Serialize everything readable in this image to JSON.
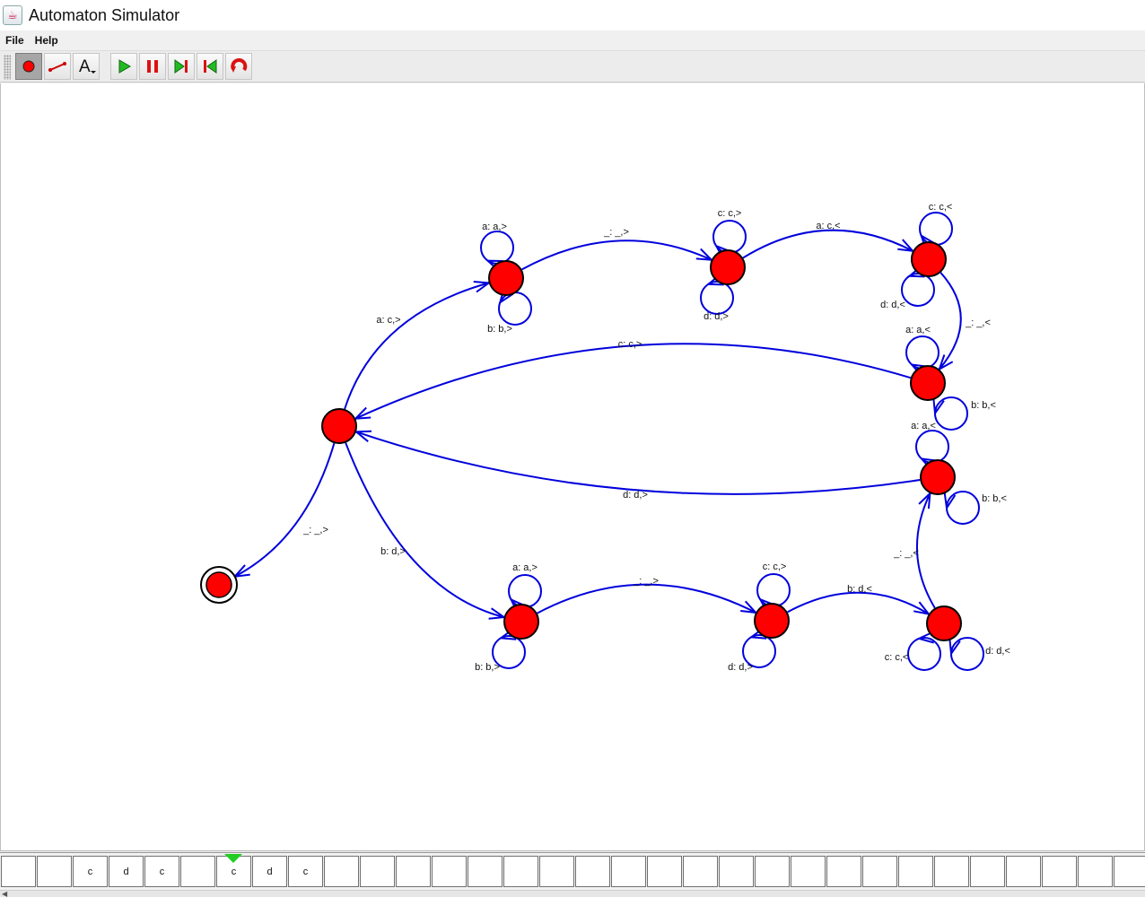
{
  "window": {
    "title": "Automaton Simulator",
    "icon": "java-cup-icon"
  },
  "menu": [
    {
      "label": "File"
    },
    {
      "label": "Help"
    }
  ],
  "toolbar": {
    "tools": [
      {
        "name": "add-state-tool-button",
        "icon": "red-circle-icon",
        "selected": true
      },
      {
        "name": "add-transition-tool-button",
        "icon": "transition-arrow-icon",
        "selected": false
      },
      {
        "name": "add-label-tool-button",
        "icon": "text-A-icon",
        "selected": false
      }
    ],
    "controls": [
      {
        "name": "run-button",
        "icon": "play-icon"
      },
      {
        "name": "pause-button",
        "icon": "pause-icon"
      },
      {
        "name": "step-forward-button",
        "icon": "step-forward-icon"
      },
      {
        "name": "step-back-button",
        "icon": "step-back-icon"
      },
      {
        "name": "reset-button",
        "icon": "reset-icon"
      }
    ]
  },
  "colors": {
    "state_fill": "#ff0000",
    "edge": "#0000dd",
    "head": "#22cc22"
  },
  "automaton": {
    "states": [
      {
        "id": "q_start",
        "accepting": false
      },
      {
        "id": "q_a1",
        "accepting": false
      },
      {
        "id": "q_a2",
        "accepting": false
      },
      {
        "id": "q_a3",
        "accepting": false
      },
      {
        "id": "q_a4",
        "accepting": false
      },
      {
        "id": "q_b1",
        "accepting": false
      },
      {
        "id": "q_b2",
        "accepting": false
      },
      {
        "id": "q_b3",
        "accepting": false
      },
      {
        "id": "q_b4",
        "accepting": false
      },
      {
        "id": "q_accept",
        "accepting": true
      }
    ],
    "transitions": [
      {
        "from": "q_start",
        "to": "q_a1",
        "label": "a: c,>"
      },
      {
        "from": "q_a1",
        "to": "q_a1",
        "label": "a: a,>"
      },
      {
        "from": "q_a1",
        "to": "q_a1",
        "label": "b: b,>"
      },
      {
        "from": "q_a1",
        "to": "q_a2",
        "label": "_: _,>"
      },
      {
        "from": "q_a2",
        "to": "q_a2",
        "label": "c: c,>"
      },
      {
        "from": "q_a2",
        "to": "q_a2",
        "label": "d: d,>"
      },
      {
        "from": "q_a2",
        "to": "q_a3",
        "label": "a: c,<"
      },
      {
        "from": "q_a3",
        "to": "q_a3",
        "label": "c: c,<"
      },
      {
        "from": "q_a3",
        "to": "q_a3",
        "label": "d: d,<"
      },
      {
        "from": "q_a3",
        "to": "q_a4",
        "label": "_: _,<"
      },
      {
        "from": "q_a4",
        "to": "q_a4",
        "label": "a: a,<"
      },
      {
        "from": "q_a4",
        "to": "q_a4",
        "label": "b: b,<"
      },
      {
        "from": "q_a4",
        "to": "q_start",
        "label": "c: c,>"
      },
      {
        "from": "q_start",
        "to": "q_b1",
        "label": "b: d,>"
      },
      {
        "from": "q_b1",
        "to": "q_b1",
        "label": "a: a,>"
      },
      {
        "from": "q_b1",
        "to": "q_b1",
        "label": "b: b,>"
      },
      {
        "from": "q_b1",
        "to": "q_b2",
        "label": "_: _,>"
      },
      {
        "from": "q_b2",
        "to": "q_b2",
        "label": "c: c,>"
      },
      {
        "from": "q_b2",
        "to": "q_b2",
        "label": "d: d,>"
      },
      {
        "from": "q_b2",
        "to": "q_b3",
        "label": "b: d,<"
      },
      {
        "from": "q_b3",
        "to": "q_b3",
        "label": "c: c,<"
      },
      {
        "from": "q_b3",
        "to": "q_b3",
        "label": "d: d,<"
      },
      {
        "from": "q_b3",
        "to": "q_b4",
        "label": "_: _,<"
      },
      {
        "from": "q_b4",
        "to": "q_b4",
        "label": "a: a,<"
      },
      {
        "from": "q_b4",
        "to": "q_b4",
        "label": "b: b,<"
      },
      {
        "from": "q_b4",
        "to": "q_start",
        "label": "d: d,>"
      },
      {
        "from": "q_start",
        "to": "q_accept",
        "label": "_: _,>"
      }
    ]
  },
  "tape": {
    "cells": [
      "",
      "",
      "c",
      "d",
      "c",
      "",
      "c",
      "d",
      "c",
      "",
      "",
      "",
      "",
      "",
      "",
      "",
      "",
      "",
      "",
      "",
      "",
      "",
      "",
      "",
      "",
      "",
      "",
      "",
      "",
      "",
      "",
      ""
    ],
    "head_index": 6
  }
}
